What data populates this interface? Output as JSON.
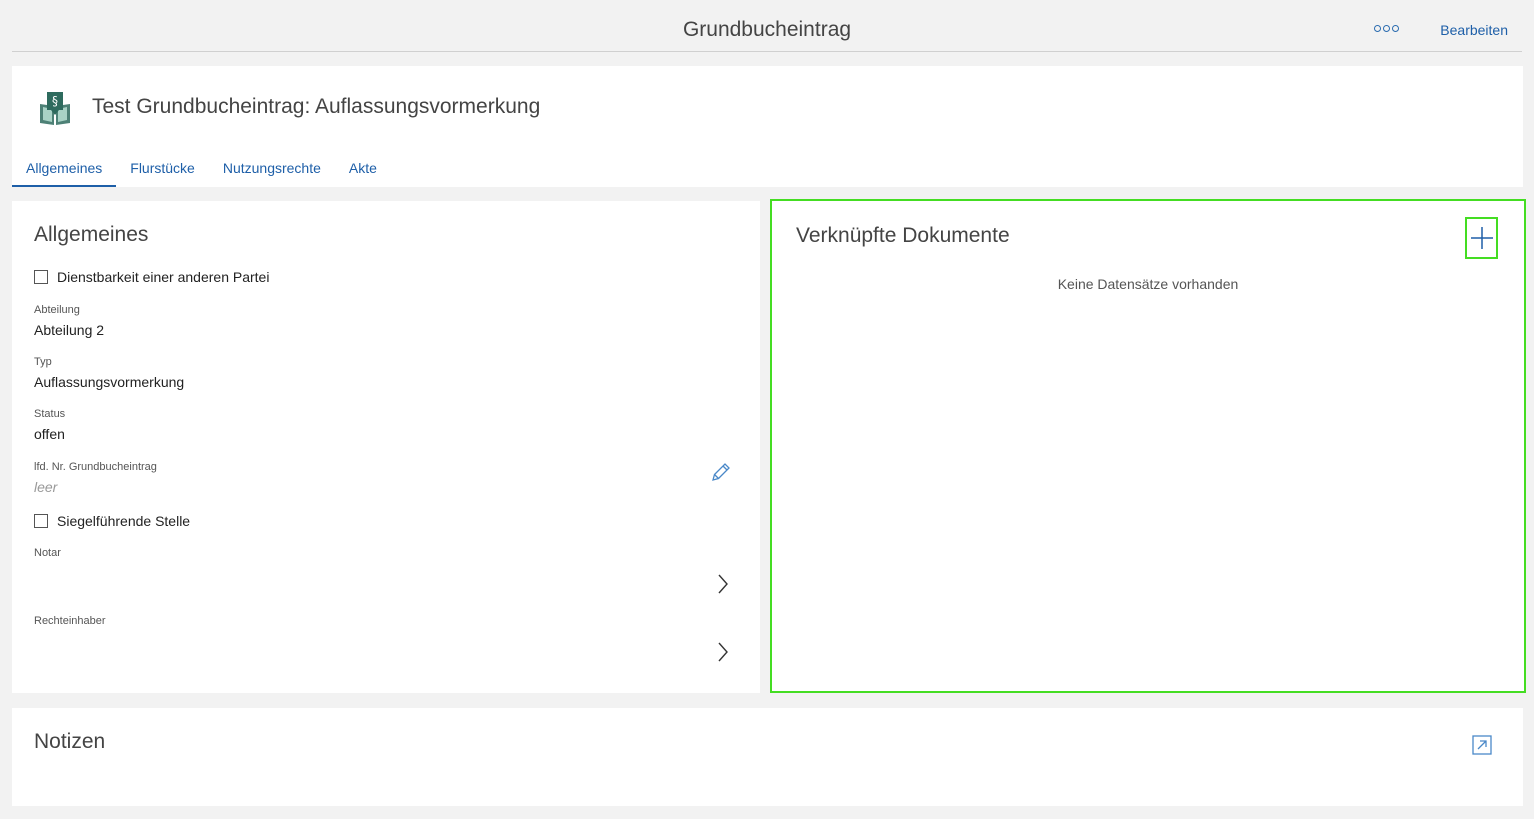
{
  "header": {
    "title": "Grundbucheintrag",
    "more_icon": "more-dots-icon",
    "edit_label": "Bearbeiten"
  },
  "record": {
    "icon": "law-book-icon",
    "title": "Test Grundbucheintrag: Auflassungsvormerkung",
    "tabs": [
      {
        "label": "Allgemeines",
        "active": true
      },
      {
        "label": "Flurstücke",
        "active": false
      },
      {
        "label": "Nutzungsrechte",
        "active": false
      },
      {
        "label": "Akte",
        "active": false
      }
    ]
  },
  "general": {
    "title": "Allgemeines",
    "servitude_label": "Dienstbarkeit einer anderen Partei",
    "servitude_checked": false,
    "department_label": "Abteilung",
    "department_value": "Abteilung 2",
    "type_label": "Typ",
    "type_value": "Auflassungsvormerkung",
    "status_label": "Status",
    "status_value": "offen",
    "entry_no_label": "lfd. Nr. Grundbucheintrag",
    "entry_no_value": "leer",
    "seal_label": "Siegelführende Stelle",
    "seal_checked": false,
    "notary_label": "Notar",
    "rights_holder_label": "Rechteinhaber"
  },
  "documents": {
    "title": "Verknüpfte Dokumente",
    "empty_message": "Keine Datensätze vorhanden",
    "add_icon": "plus-icon",
    "highlight_color": "#44dd22"
  },
  "notes": {
    "title": "Notizen",
    "open_icon": "open-external-icon"
  },
  "colors": {
    "accent": "#1e5fa8",
    "icon_green": "#2e6b5e"
  }
}
